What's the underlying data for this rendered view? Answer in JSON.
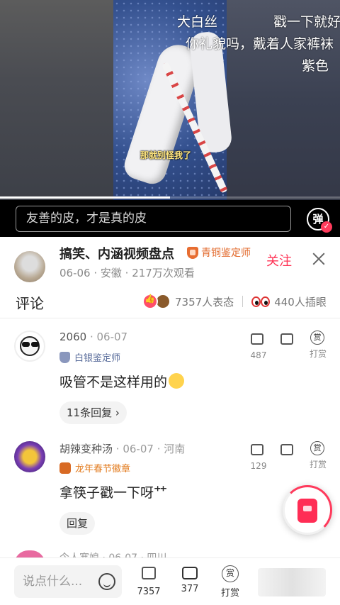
{
  "video": {
    "subtitle": "那就别怪我了",
    "danmaku": [
      "大白丝",
      "戳一下就好",
      "你礼貌吗，戴着人家裤袜",
      "紫色"
    ],
    "progress": 0.5
  },
  "danmaku_bar": {
    "placeholder": "友善的皮，才是真的皮",
    "toggle_label": "弹"
  },
  "author": {
    "name": "搞笑、内涵视频盘点",
    "badge": "青铜鉴定师",
    "meta": "06-06 · 安徽 · 217万次观看",
    "follow": "关注"
  },
  "comments_header": {
    "title": "评论",
    "reactions_text": "7357人表态",
    "eyes_text": "440人插眼"
  },
  "comments": [
    {
      "user": "2060",
      "date": "06-07",
      "badge": "白银鉴定师",
      "text": "吸管不是这样用的",
      "reply_label": "11条回复 ›",
      "likes": "487",
      "tip_label": "打赏"
    },
    {
      "user": "胡辣变种汤",
      "date": "06-07 · 河南",
      "badge": "龙年春节徽章",
      "text": "拿筷子戳一下呀⺿",
      "reply_label": "回复",
      "likes": "129",
      "tip_label": "打赏"
    }
  ],
  "peek_comment": {
    "text": "今人寒娘 · 06-07 · 四川"
  },
  "bottom_bar": {
    "placeholder": "说点什么...",
    "likes": "7357",
    "comments": "377",
    "tip": "打赏",
    "tip_glyph": "赏"
  },
  "colors": {
    "accent": "#ff3355",
    "danmaku_bg": "#000000"
  }
}
